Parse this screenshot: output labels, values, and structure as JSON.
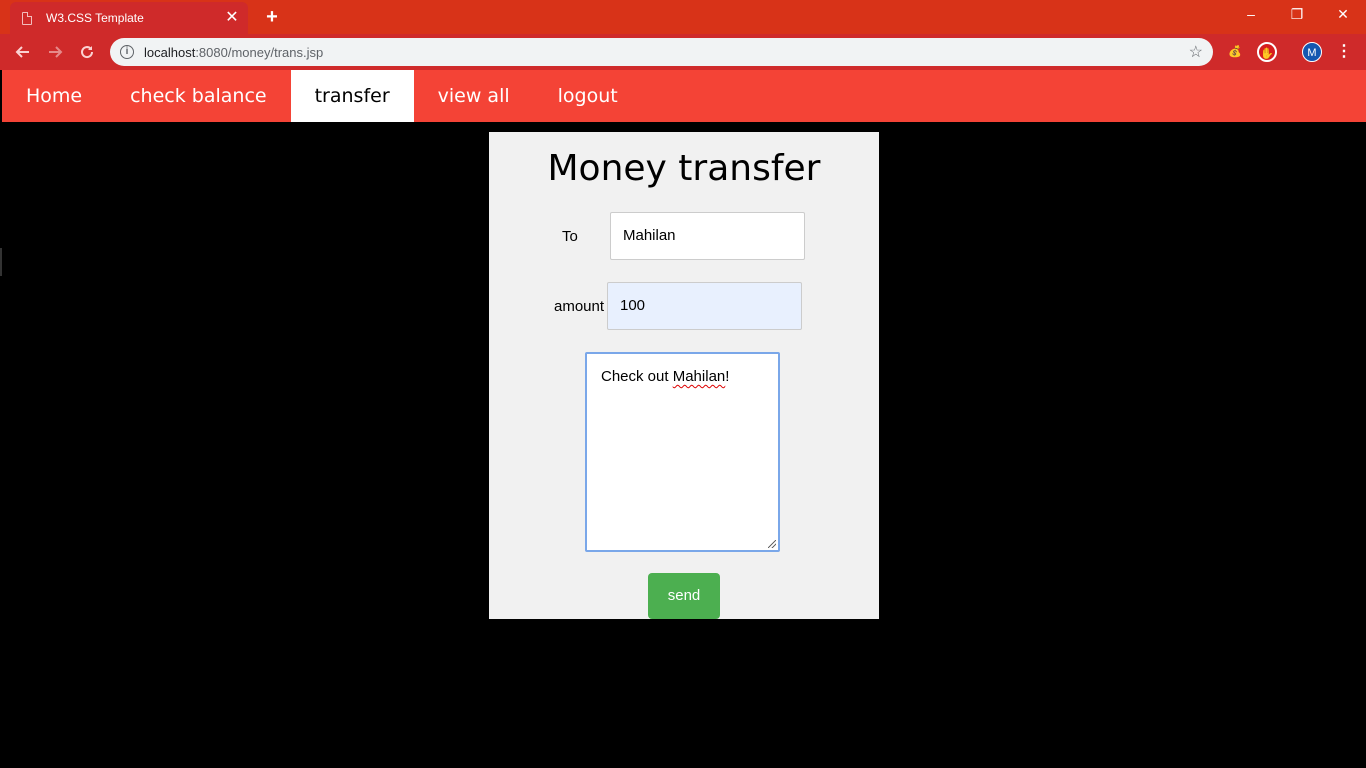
{
  "browser": {
    "tab_title": "W3.CSS Template",
    "tab_close": "✕",
    "new_tab": "+",
    "url_host": "localhost",
    "url_path": ":8080/money/trans.jsp",
    "avatar_letter": "M",
    "window": {
      "minimize": "–",
      "restore": "❐",
      "close": "✕"
    }
  },
  "nav": {
    "items": [
      {
        "label": "Home",
        "active": false
      },
      {
        "label": "check balance",
        "active": false
      },
      {
        "label": "transfer",
        "active": true
      },
      {
        "label": "view all",
        "active": false
      },
      {
        "label": "logout",
        "active": false
      }
    ]
  },
  "form": {
    "title": "Money transfer",
    "to_label": "To",
    "to_value": "Mahilan",
    "amount_label": "amount",
    "amount_value": "100",
    "message_prefix": "Check out ",
    "message_misspelled": "Mahilan",
    "message_suffix": "!",
    "send_label": "send"
  },
  "colors": {
    "tabbar": "#d83318",
    "nav_bg": "#f44336",
    "card_bg": "#f1f1f1",
    "send_bg": "#4caf50",
    "autofill_bg": "#e8f0fe"
  },
  "icons": {
    "back": "arrow-left-icon",
    "forward": "arrow-right-icon",
    "reload": "reload-icon",
    "info": "info-icon",
    "bookmark": "star-icon",
    "menu": "kebab-menu-icon"
  }
}
